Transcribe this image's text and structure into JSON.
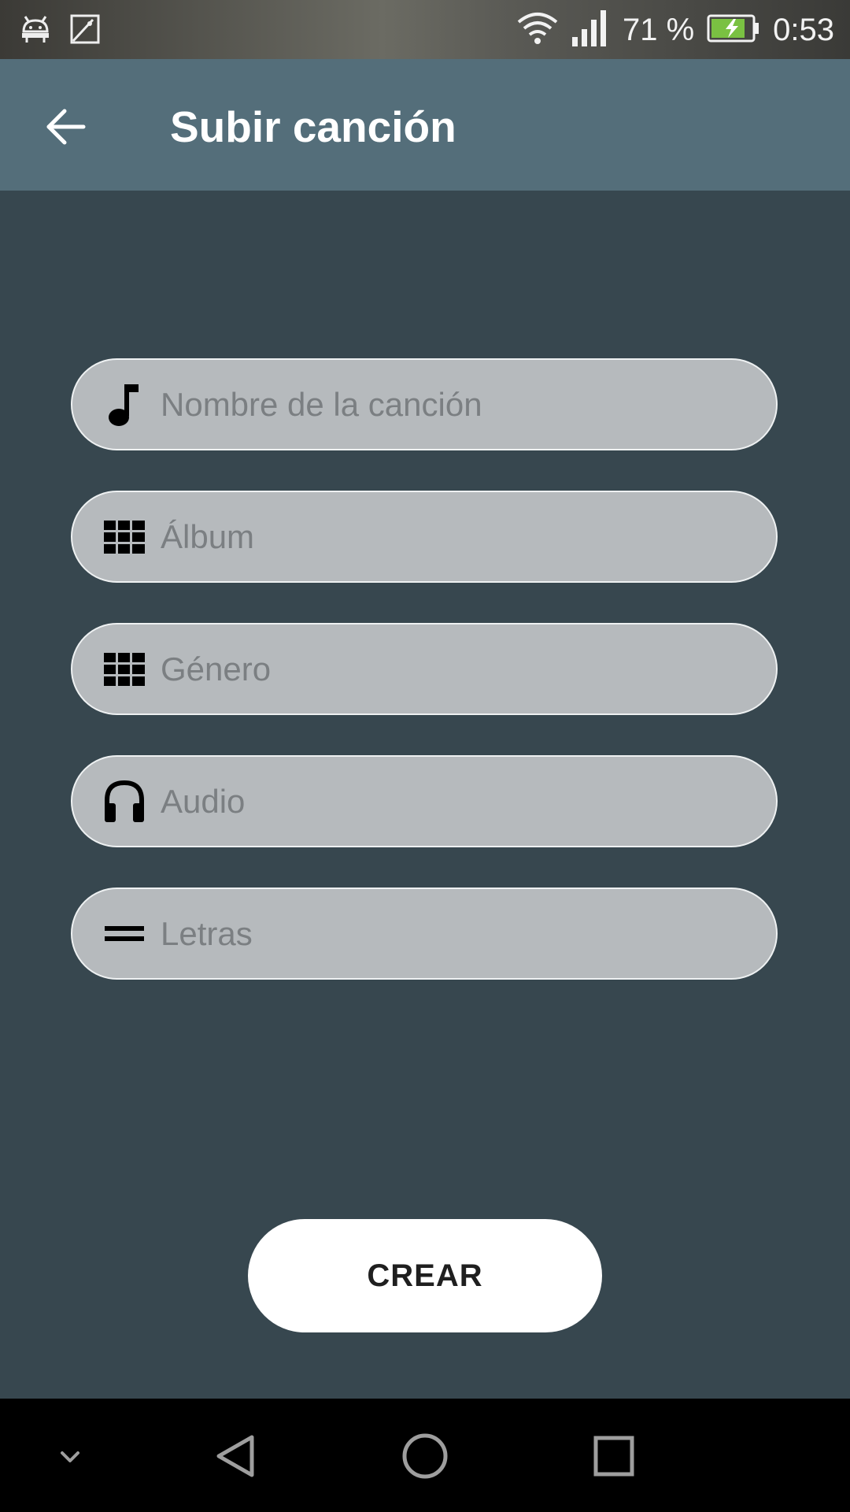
{
  "status_bar": {
    "icons_left": [
      "android-icon",
      "image-icon"
    ],
    "icons_right": [
      "wifi-icon",
      "signal-icon",
      "battery-charging-icon"
    ],
    "battery_percent": "71 %",
    "time": "0:53"
  },
  "app_bar": {
    "title": "Subir canción",
    "back_icon": "arrow-back-icon",
    "background": "#546e7a"
  },
  "form": {
    "fields": [
      {
        "icon": "music-note-icon",
        "placeholder": "Nombre de la canción",
        "value": ""
      },
      {
        "icon": "grid-icon",
        "placeholder": "Álbum",
        "value": ""
      },
      {
        "icon": "grid-icon",
        "placeholder": "Género",
        "value": ""
      },
      {
        "icon": "headphones-icon",
        "placeholder": "Audio",
        "value": ""
      },
      {
        "icon": "lines-icon",
        "placeholder": "Letras",
        "value": ""
      }
    ],
    "submit_label": "CREAR"
  },
  "nav_bar": {
    "buttons": [
      "chevron-down-icon",
      "nav-back-icon",
      "home-icon",
      "recents-icon"
    ]
  },
  "colors": {
    "background": "#37474f",
    "field_background": "#b6babd",
    "button_background": "#ffffff"
  }
}
